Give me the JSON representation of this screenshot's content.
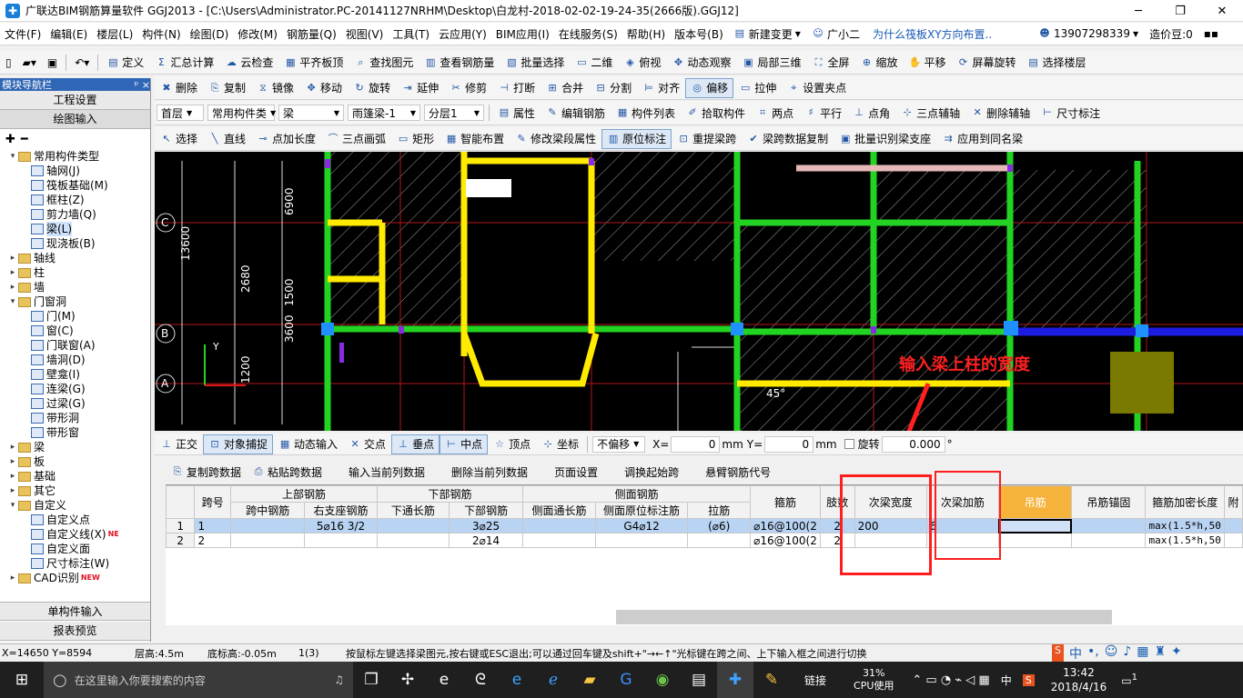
{
  "window": {
    "title": "广联达BIM钢筋算量软件 GGJ2013 - [C:\\Users\\Administrator.PC-20141127NRHM\\Desktop\\白龙村-2018-02-02-19-24-35(2666版).GGJ12]",
    "app_icon": "glodon-app-icon",
    "minimize": "─",
    "maximize": "❐",
    "close": "✕"
  },
  "menu": {
    "items": [
      "文件(F)",
      "编辑(E)",
      "楼层(L)",
      "构件(N)",
      "绘图(D)",
      "修改(M)",
      "钢筋量(Q)",
      "视图(V)",
      "工具(T)",
      "云应用(Y)",
      "BIM应用(I)",
      "在线服务(S)",
      "帮助(H)",
      "版本号(B)"
    ],
    "new_change": "新建变更",
    "assistant": "广小二",
    "question": "为什么筏板XY方向布置..",
    "phone": "13907298339",
    "price": "造价豆:0"
  },
  "toolbar1": {
    "items": [
      "定义",
      "汇总计算",
      "云检查",
      "平齐板顶",
      "查找图元",
      "查看钢筋量",
      "批量选择",
      "二维",
      "俯视",
      "动态观察",
      "局部三维",
      "全屏",
      "缩放",
      "平移",
      "屏幕旋转",
      "选择楼层"
    ]
  },
  "toolbar2": {
    "items": [
      "删除",
      "复制",
      "镜像",
      "移动",
      "旋转",
      "延伸",
      "修剪",
      "打断",
      "合并",
      "分割",
      "对齐",
      "偏移",
      "拉伸",
      "设置夹点"
    ]
  },
  "toolbar3": {
    "floor": "首层",
    "type": "常用构件类",
    "element": "梁",
    "beam": "雨篷梁-1",
    "layer": "分层1",
    "items": [
      "属性",
      "编辑钢筋",
      "构件列表",
      "拾取构件",
      "两点",
      "平行",
      "点角",
      "三点辅轴",
      "删除辅轴",
      "尺寸标注"
    ]
  },
  "toolbar4": {
    "items": [
      "选择",
      "直线",
      "点加长度",
      "三点画弧",
      "矩形",
      "智能布置",
      "修改梁段属性",
      "原位标注",
      "重提梁跨",
      "梁跨数据复制",
      "批量识别梁支座",
      "应用到同名梁"
    ]
  },
  "nav": {
    "header": "模块导航栏",
    "pin": "ᵖ",
    "close": "×",
    "btn_project": "工程设置",
    "btn_draw": "绘图输入",
    "btn_single": "单构件输入",
    "btn_report": "报表预览",
    "tree": [
      {
        "label": "常用构件类型",
        "level": 0,
        "type": "folder",
        "open": true
      },
      {
        "label": "轴网(J)",
        "level": 1,
        "type": "item"
      },
      {
        "label": "筏板基础(M)",
        "level": 1,
        "type": "item"
      },
      {
        "label": "框柱(Z)",
        "level": 1,
        "type": "item"
      },
      {
        "label": "剪力墙(Q)",
        "level": 1,
        "type": "item"
      },
      {
        "label": "梁(L)",
        "level": 1,
        "type": "item",
        "selected": true
      },
      {
        "label": "现浇板(B)",
        "level": 1,
        "type": "item"
      },
      {
        "label": "轴线",
        "level": 0,
        "type": "folder"
      },
      {
        "label": "柱",
        "level": 0,
        "type": "folder"
      },
      {
        "label": "墙",
        "level": 0,
        "type": "folder"
      },
      {
        "label": "门窗洞",
        "level": 0,
        "type": "folder",
        "open": true
      },
      {
        "label": "门(M)",
        "level": 1,
        "type": "item"
      },
      {
        "label": "窗(C)",
        "level": 1,
        "type": "item"
      },
      {
        "label": "门联窗(A)",
        "level": 1,
        "type": "item"
      },
      {
        "label": "墙洞(D)",
        "level": 1,
        "type": "item"
      },
      {
        "label": "壁龛(I)",
        "level": 1,
        "type": "item"
      },
      {
        "label": "连梁(G)",
        "level": 1,
        "type": "item"
      },
      {
        "label": "过梁(G)",
        "level": 1,
        "type": "item"
      },
      {
        "label": "带形洞",
        "level": 1,
        "type": "item"
      },
      {
        "label": "带形窗",
        "level": 1,
        "type": "item"
      },
      {
        "label": "梁",
        "level": 0,
        "type": "folder"
      },
      {
        "label": "板",
        "level": 0,
        "type": "folder"
      },
      {
        "label": "基础",
        "level": 0,
        "type": "folder"
      },
      {
        "label": "其它",
        "level": 0,
        "type": "folder"
      },
      {
        "label": "自定义",
        "level": 0,
        "type": "folder",
        "open": true
      },
      {
        "label": "自定义点",
        "level": 1,
        "type": "item"
      },
      {
        "label": "自定义线(X)",
        "level": 1,
        "type": "item",
        "badge": "NE"
      },
      {
        "label": "自定义面",
        "level": 1,
        "type": "item"
      },
      {
        "label": "尺寸标注(W)",
        "level": 1,
        "type": "item"
      },
      {
        "label": "CAD识别",
        "level": 0,
        "type": "folder",
        "badge": "NEW"
      }
    ]
  },
  "canvas": {
    "axis_labels": [
      "C",
      "B",
      "A"
    ],
    "dim_labels": [
      "13600",
      "2680",
      "1200",
      "3600",
      "1500",
      "6900"
    ],
    "angle": "45°",
    "y_axis": "Y",
    "annotation": "输入梁上柱的宽度"
  },
  "snapbar": {
    "items": [
      "正交",
      "对象捕捉",
      "动态输入",
      "交点",
      "垂点",
      "中点",
      "顶点",
      "坐标"
    ],
    "offset": "不偏移",
    "x_label": "X=",
    "x_value": "0",
    "y_label": "Y=",
    "y_value": "0",
    "unit": "mm",
    "rotate_label": "旋转",
    "rotate_value": "0.000",
    "degree": "°"
  },
  "gridbar": {
    "items": [
      "复制跨数据",
      "粘贴跨数据",
      "输入当前列数据",
      "删除当前列数据",
      "页面设置",
      "调换起始跨",
      "悬臂钢筋代号"
    ]
  },
  "table": {
    "group_headers": [
      "跨号",
      "上部钢筋",
      "下部钢筋",
      "侧面钢筋",
      "箍筋",
      "肢数",
      "次梁宽度",
      "次梁加筋",
      "吊筋",
      "吊筋锚固",
      "箍筋加密长度",
      "附"
    ],
    "sub_headers": [
      "跨中钢筋",
      "右支座钢筋",
      "下通长筋",
      "下部钢筋",
      "侧面通长筋",
      "侧面原位标注筋",
      "拉筋"
    ],
    "rows": [
      {
        "idx": "1",
        "span": "1",
        "top_mid": "",
        "top_right": "5⌀16 3/2",
        "bot_through": "",
        "bot": "3⌀25",
        "side_through": "",
        "side_orig": "G4⌀12",
        "tie": "(⌀6)",
        "stirrup": "⌀16@100(2",
        "legs": "2",
        "sec_width": "200",
        "sec_add": "6",
        "hanger": "",
        "hanger_anchor": "",
        "dense_len": "max(1.5*h,50"
      },
      {
        "idx": "2",
        "span": "2",
        "top_mid": "",
        "top_right": "",
        "bot_through": "",
        "bot": "2⌀14",
        "side_through": "",
        "side_orig": "",
        "tie": "",
        "stirrup": "⌀16@100(2",
        "legs": "2",
        "sec_width": "",
        "sec_add": "",
        "hanger": "",
        "hanger_anchor": "",
        "dense_len": "max(1.5*h,50"
      }
    ]
  },
  "status": {
    "coords": "X=14650 Y=8594",
    "floor_height": "层高:4.5m",
    "bottom_elev": "底标高:-0.05m",
    "sel": "1(3)",
    "hint": "按鼠标左键选择梁图元,按右键或ESC退出;可以通过回车键及shift+\"→←↑\"光标键在跨之间、上下输入框之间进行切换"
  },
  "taskbar": {
    "search_placeholder": "在这里输入你要搜索的内容",
    "link": "链接",
    "cpu_percent": "31%",
    "cpu_label": "CPU使用",
    "ime": "中",
    "time": "13:42",
    "date": "2018/4/16",
    "notify": "1"
  }
}
